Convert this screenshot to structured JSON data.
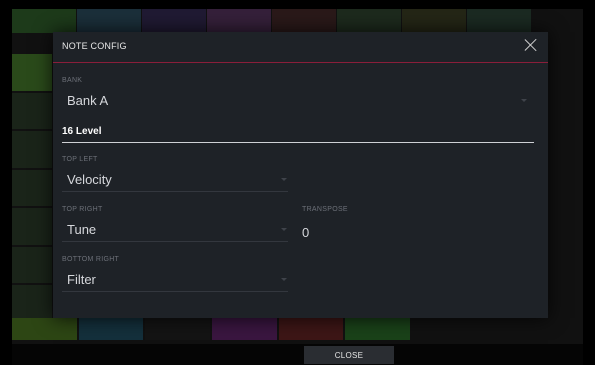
{
  "dialog": {
    "title": "NOTE CONFIG",
    "bank": {
      "label": "BANK",
      "value": "Bank A"
    },
    "section_title": "16 Level",
    "top_left": {
      "label": "TOP LEFT",
      "value": "Velocity"
    },
    "top_right": {
      "label": "TOP RIGHT",
      "value": "Tune"
    },
    "transpose": {
      "label": "TRANSPOSE",
      "value": "0"
    },
    "bottom_right": {
      "label": "BOTTOM RIGHT",
      "value": "Filter"
    }
  },
  "bottom_bar": {
    "close_label": "CLOSE"
  },
  "colors": {
    "dialog_bg": "#1e2227",
    "accent": "#8a1e3a",
    "label": "#6c7078",
    "value": "#d6d8dc"
  },
  "icons": {
    "close": "close-icon",
    "dropdown": "chevron-down-icon"
  }
}
